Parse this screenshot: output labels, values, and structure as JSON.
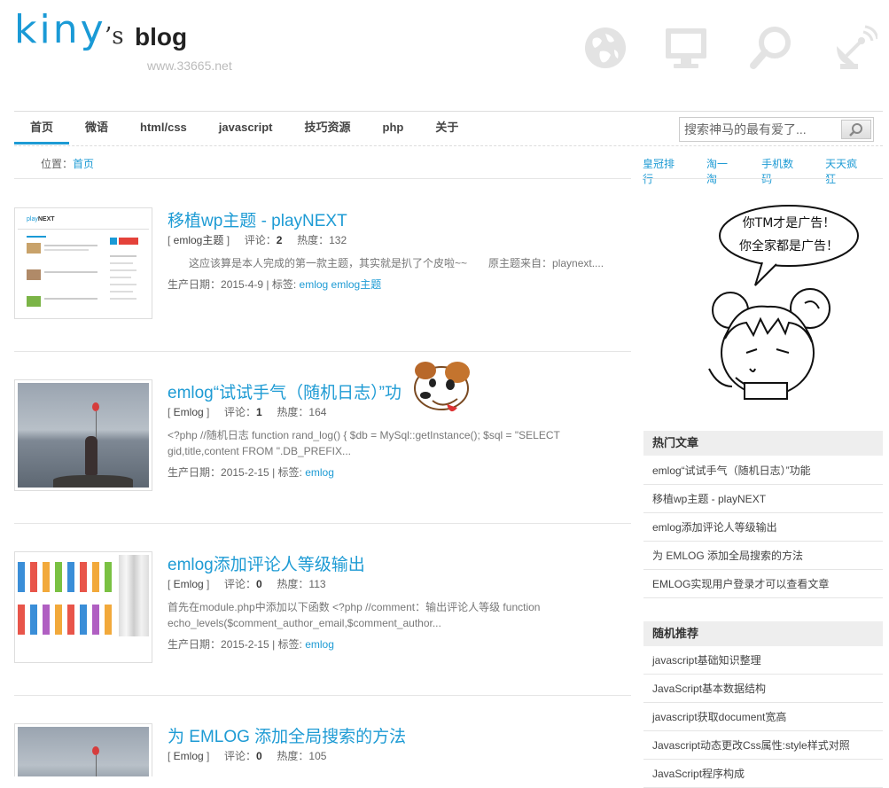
{
  "header": {
    "logo_main": "kiny",
    "logo_apostrophe_s": "’s",
    "logo_blog": "blog",
    "site_url": "www.33665.net",
    "icons": [
      "globe-icon",
      "monitor-icon",
      "magnifier-icon",
      "satellite-icon"
    ]
  },
  "nav": {
    "items": [
      {
        "label": "首页",
        "active": true
      },
      {
        "label": "微语"
      },
      {
        "label": "html/css"
      },
      {
        "label": "javascript"
      },
      {
        "label": "技巧资源"
      },
      {
        "label": "php"
      },
      {
        "label": "关于"
      }
    ],
    "search_placeholder": "搜索神马的最有爱了..."
  },
  "breadcrumb": {
    "prefix": "位置：",
    "current": "首页"
  },
  "quick_links": [
    "皇冠排行",
    "淘一淘",
    "手机数码",
    "天天疯狂"
  ],
  "posts": [
    {
      "title": "移植wp主题 - playNEXT",
      "category": "emlog主题",
      "comments_label": "评论：",
      "comments": "2",
      "heat_label": "热度：",
      "heat": "132",
      "excerpt": "　　这应该算是本人完成的第一款主题，其实就是扒了个皮啦~~　　原主题来自：playnext....",
      "date_label": "生产日期：",
      "date": "2015-4-9",
      "tags_label": " | 标签: ",
      "tags": "emlog emlog主题"
    },
    {
      "title": "emlog“试试手气（随机日志）”功",
      "category": "Emlog",
      "comments_label": "评论：",
      "comments": "1",
      "heat_label": "热度：",
      "heat": "164",
      "excerpt": "<?php //随机日志 function rand_log() { $db = MySql::getInstance(); $sql = \"SELECT gid,title,content FROM \".DB_PREFIX...",
      "date_label": "生产日期：",
      "date": "2015-2-15",
      "tags_label": " | 标签: ",
      "tags": "emlog"
    },
    {
      "title": "emlog添加评论人等级输出",
      "category": "Emlog",
      "comments_label": "评论：",
      "comments": "0",
      "heat_label": "热度：",
      "heat": "113",
      "excerpt": "首先在module.php中添加以下函数 <?php //comment：输出评论人等级 function echo_levels($comment_author_email,$comment_author...",
      "date_label": "生产日期：",
      "date": "2015-2-15",
      "tags_label": " | 标签: ",
      "tags": "emlog"
    },
    {
      "title": "为 EMLOG 添加全局搜索的方法",
      "category": "Emlog",
      "comments_label": "评论：",
      "comments": "0",
      "heat_label": "热度：",
      "heat": "105"
    }
  ],
  "sidebar": {
    "ad_bubble_line1": "你TM才是广告！",
    "ad_bubble_line2": "你全家都是广告！",
    "hot": {
      "title": "热门文章",
      "items": [
        "emlog“试试手气（随机日志）”功能",
        "移植wp主题 - playNEXT",
        "emlog添加评论人等级输出",
        "为 EMLOG 添加全局搜索的方法",
        "EMLOG实现用户登录才可以查看文章"
      ]
    },
    "random": {
      "title": "随机推荐",
      "items": [
        "javascript基础知识整理",
        "JavaScript基本数据结构",
        "javascript获取document宽高",
        "Javascript动态更改Css属性:style样式对照",
        "JavaScript程序构成"
      ]
    }
  },
  "colors": {
    "accent": "#1e9bd4",
    "logo": "#1a9ad6",
    "icon_gray": "#e0e0e0"
  }
}
